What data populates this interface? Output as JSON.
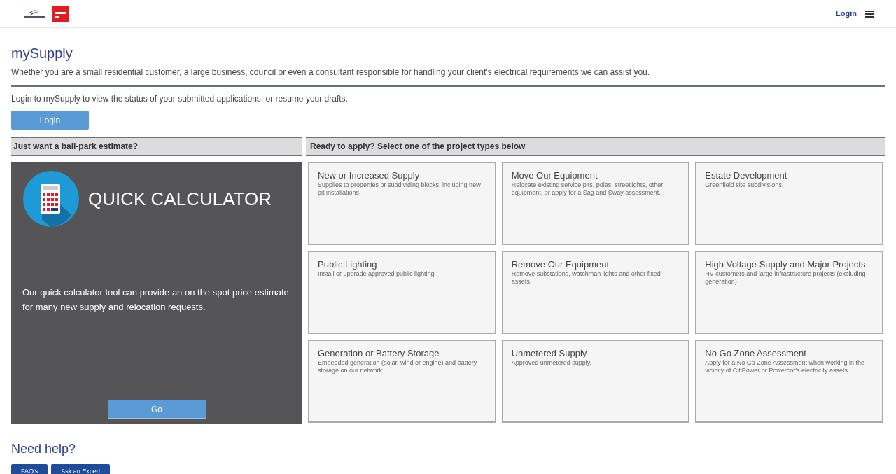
{
  "header": {
    "login": "Login"
  },
  "title": "mySupply",
  "intro": "Whether you are a small residential customer, a large business, council or even a consultant responsible for handling your client's electrical requirements we can assist you.",
  "login_prompt": "Login to mySupply to view the status of your submitted applications, or resume your drafts.",
  "login_button": "Login",
  "estimate": {
    "heading": "Just want a ball-park estimate?",
    "title": "QUICK CALCULATOR",
    "description": "Our quick calculator tool can provide an on the spot price estimate for many new supply and relocation requests.",
    "button": "Go"
  },
  "projects": {
    "heading": "Ready to apply? Select one of the project types below",
    "items": [
      {
        "title": "New or Increased Supply",
        "description": "Supplies to properties or subdividing blocks, including new pit installations."
      },
      {
        "title": "Move Our Equipment",
        "description": "Relocate existing service pits, poles, streetlights, other equipment, or apply for a Sag and Sway assessment."
      },
      {
        "title": "Estate Development",
        "description": "Greenfield site subdivisions."
      },
      {
        "title": "Public Lighting",
        "description": "Install or upgrade approved public lighting."
      },
      {
        "title": "Remove Our Equipment",
        "description": "Remove substations, watchman lights and other fixed assets."
      },
      {
        "title": "High Voltage Supply and Major Projects",
        "description": "HV customers and large infrastructure projects (excluding generation)"
      },
      {
        "title": "Generation or Battery Storage",
        "description": "Embedded generation (solar, wind or engine) and battery storage on our network."
      },
      {
        "title": "Unmetered Supply",
        "description": "Approved unmetered supply."
      },
      {
        "title": "No Go Zone Assessment",
        "description": "Apply for a No Go Zone Assessment when working in the vicinity of CitiPower or Powercor's electricity assets"
      }
    ]
  },
  "help": {
    "heading": "Need help?",
    "buttons": [
      "FAQ's",
      "Ask an Expert"
    ]
  }
}
